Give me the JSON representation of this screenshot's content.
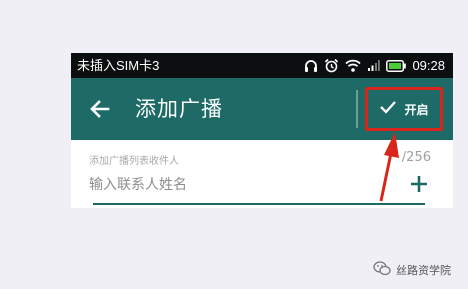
{
  "status_bar": {
    "carrier": "未插入SIM卡3",
    "time": "09:28",
    "icons": [
      "headphones-icon",
      "alarm-icon",
      "wifi-icon",
      "signal-icon",
      "battery-icon"
    ]
  },
  "action_bar": {
    "back_icon": "arrow-left-icon",
    "title": "添加广播",
    "enable_label": "开启",
    "enable_icon": "check-icon",
    "background_color": "#1d6a66",
    "highlight_color": "#d9261c"
  },
  "form": {
    "recipients_label": "添加广播列表收件人",
    "recipient_count": "/256",
    "contact_placeholder": "输入联系人姓名",
    "add_icon": "plus-icon",
    "accent_color": "#1d6a66"
  },
  "watermark": {
    "text": "丝路资学院",
    "icon": "wechat-icon"
  }
}
